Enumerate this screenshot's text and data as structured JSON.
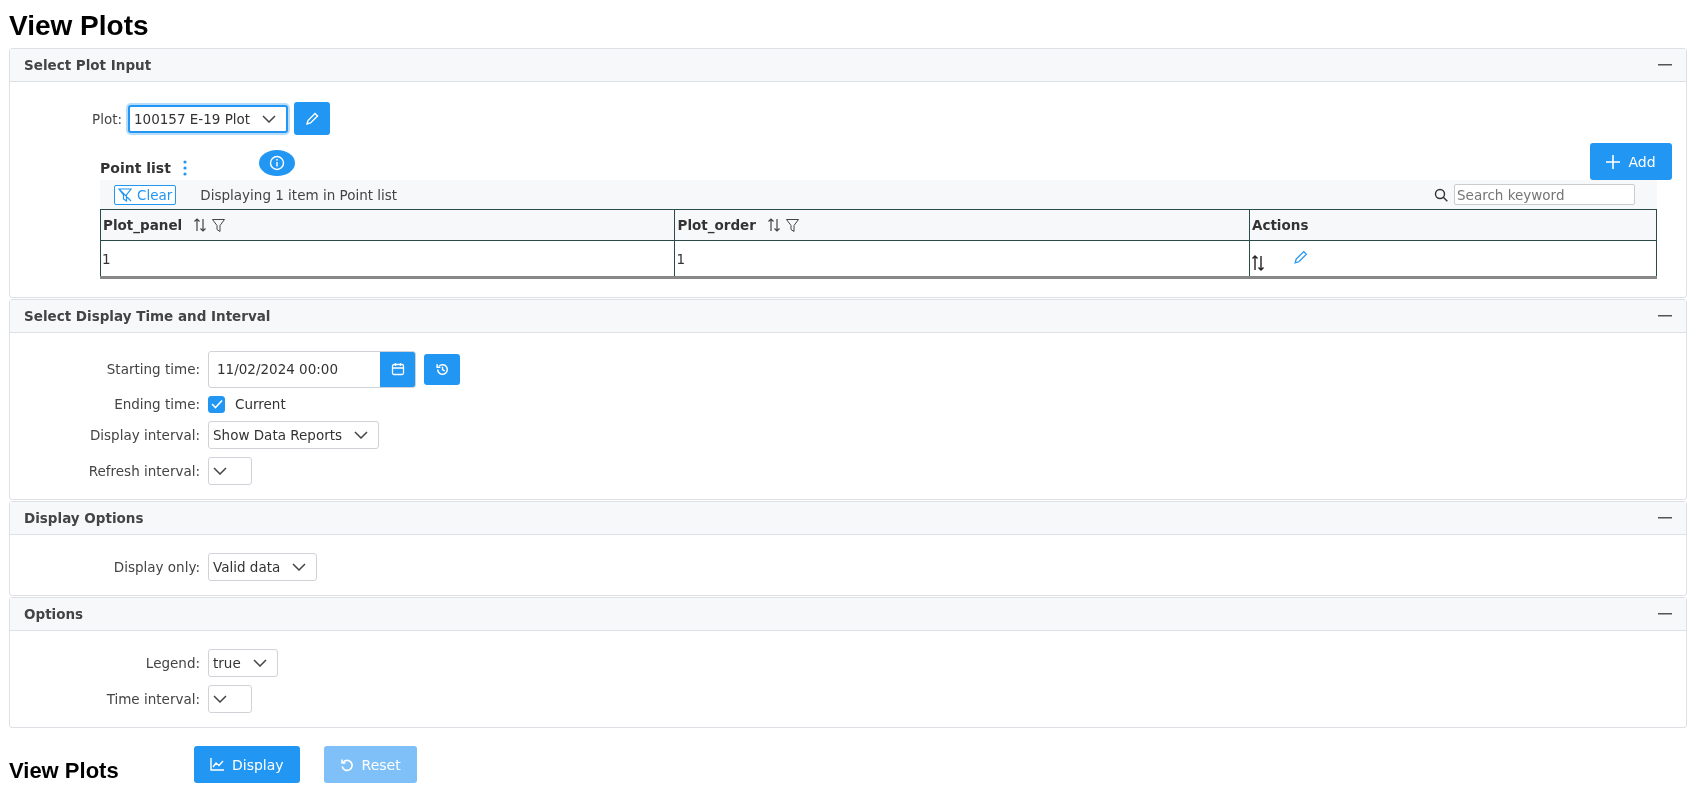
{
  "page_title": "View Plots",
  "plot_input": {
    "title": "Select Plot Input",
    "plot_label": "Plot:",
    "plot_value": "100157 E-19 Plot",
    "point_list": {
      "title": "Point list",
      "add_button": "Add",
      "clear_button": "Clear",
      "summary": "Displaying 1 item in Point list",
      "search": {
        "placeholder": "Search keyword"
      },
      "columns": [
        {
          "label": "Plot_panel",
          "sortable": true,
          "filterable": true
        },
        {
          "label": "Plot_order",
          "sortable": true,
          "filterable": true
        },
        {
          "label": "Actions",
          "sortable": false,
          "filterable": false
        }
      ],
      "rows": [
        [
          "1",
          "1"
        ]
      ]
    }
  },
  "panels": [
    {
      "title": "Select Display Time and Interval",
      "fields": [
        {
          "kind": "datetime",
          "label": "Starting time:",
          "value": "11/02/2024 00:00"
        },
        {
          "kind": "checkbox",
          "label": "Ending time:",
          "option": "Current",
          "checked": true
        },
        {
          "kind": "select",
          "label": "Display interval:",
          "value": "Show Data Reports"
        },
        {
          "kind": "select",
          "label": "Refresh interval:"
        }
      ]
    },
    {
      "title": "Display Options",
      "fields": [
        {
          "kind": "select",
          "label": "Display only:",
          "value": "Valid data"
        }
      ]
    },
    {
      "title": "Options",
      "fields": [
        {
          "kind": "select",
          "label": "Legend:",
          "value": "true"
        },
        {
          "kind": "select",
          "label": "Time interval:"
        }
      ]
    }
  ],
  "footer": {
    "title": "View Plots",
    "buttons": [
      {
        "kind": "chart",
        "label": "Display",
        "disabled": false
      },
      {
        "kind": "undo",
        "label": "Reset",
        "disabled": true
      }
    ]
  }
}
